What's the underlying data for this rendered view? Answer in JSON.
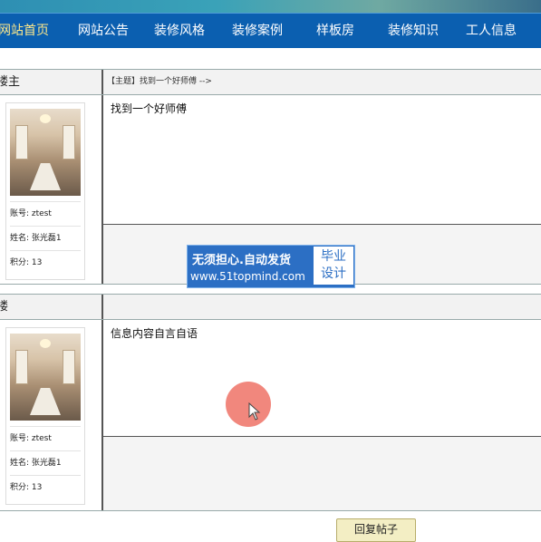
{
  "nav": {
    "items": [
      "网站首页",
      "网站公告",
      "装修风格",
      "装修案例",
      "样板房",
      "装修知识",
      "工人信息"
    ]
  },
  "posts": [
    {
      "floor": "楼主",
      "subject": "【主题】找到一个好师傅 -->",
      "content": "找到一个好师傅",
      "user": {
        "account": "账号: ztest",
        "name": "姓名: 张光磊1",
        "points": "积分: 13"
      }
    },
    {
      "floor": "楼",
      "subject": "",
      "content": "信息内容自言自语",
      "user": {
        "account": "账号: ztest",
        "name": "姓名: 张光磊1",
        "points": "积分: 13"
      }
    }
  ],
  "watermark": {
    "line1": "无须担心.自动发货",
    "line2": "www.51topmind.com",
    "badge_top": "毕业",
    "badge_bottom": "设计"
  },
  "reply_button": "回复帖子",
  "colors": {
    "nav_bg": "#0b5fb0",
    "nav_active_text": "#ffe98a",
    "header_bg": "#f2f2f2",
    "reply_button_bg": "#f3eec4"
  }
}
